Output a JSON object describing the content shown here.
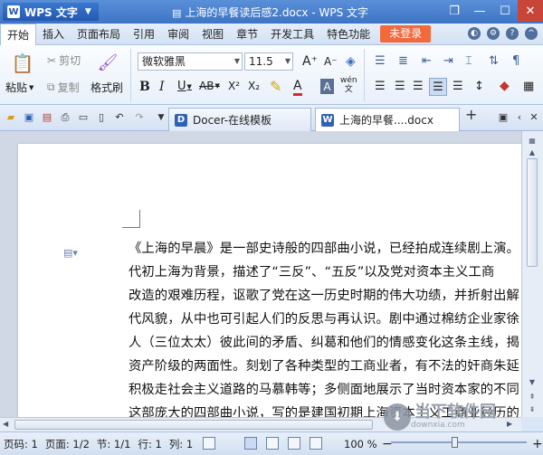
{
  "titlebar": {
    "app_name": "WPS 文字",
    "document_title": "上海的早餐读后感2.docx - WPS 文字"
  },
  "menubar": {
    "items": [
      "开始",
      "插入",
      "页面布局",
      "引用",
      "审阅",
      "视图",
      "章节",
      "开发工具",
      "特色功能"
    ],
    "login_label": "未登录"
  },
  "ribbon": {
    "paste_label": "粘贴",
    "cut_label": "剪切",
    "copy_label": "复制",
    "format_painter_label": "格式刷",
    "font_name": "微软雅黑",
    "font_size": "11.5",
    "bold": "B",
    "italic": "I",
    "underline": "U",
    "strike": "AB",
    "superscript": "X²",
    "subscript": "X₂",
    "font_color": "A",
    "grow_font": "A⁺",
    "shrink_font": "A⁻",
    "phonetic": "wén"
  },
  "tabs": {
    "items": [
      {
        "label": "Docer-在线模板"
      },
      {
        "label": "上海的早餐....docx"
      }
    ],
    "add_label": "+"
  },
  "document": {
    "lines": [
      "《上海的早晨》是一部史诗般的四部曲小说，已经拍成连续剧上演。",
      "代初上海为背景，描述了“三反”、“五反”以及党对资本主义工商",
      "改造的艰难历程，讴歌了党在这一历史时期的伟大功绩，并折射出解",
      "代风貌，从中也可引起人们的反思与再认识。剧中通过棉纺企业家徐",
      "人（三位太太）彼此间的矛盾、纠葛和他们的情感变化这条主线，揭",
      "资产阶级的两面性。刻划了各种类型的工商业者，有不法的奸商朱延",
      "积极走社会主义道路的马慕韩等；多侧面地展示了当时资本家的不同",
      "这部庞大的四部曲小说，写的是建国初期上海资本主义工商业经历的"
    ]
  },
  "statusbar": {
    "page_code": "页码: 1",
    "page": "页面: 1/2",
    "section": "节: 1/1",
    "row": "行: 1",
    "col": "列: 1",
    "zoom": "100 %",
    "zoom_minus": "−",
    "zoom_plus": "+"
  },
  "watermark": {
    "text": "当下软件园",
    "sub": "downxia.com"
  },
  "colors": {
    "title_bar": "#3d74c4",
    "login_button": "#f26a3c",
    "accent": "#2458b0"
  }
}
